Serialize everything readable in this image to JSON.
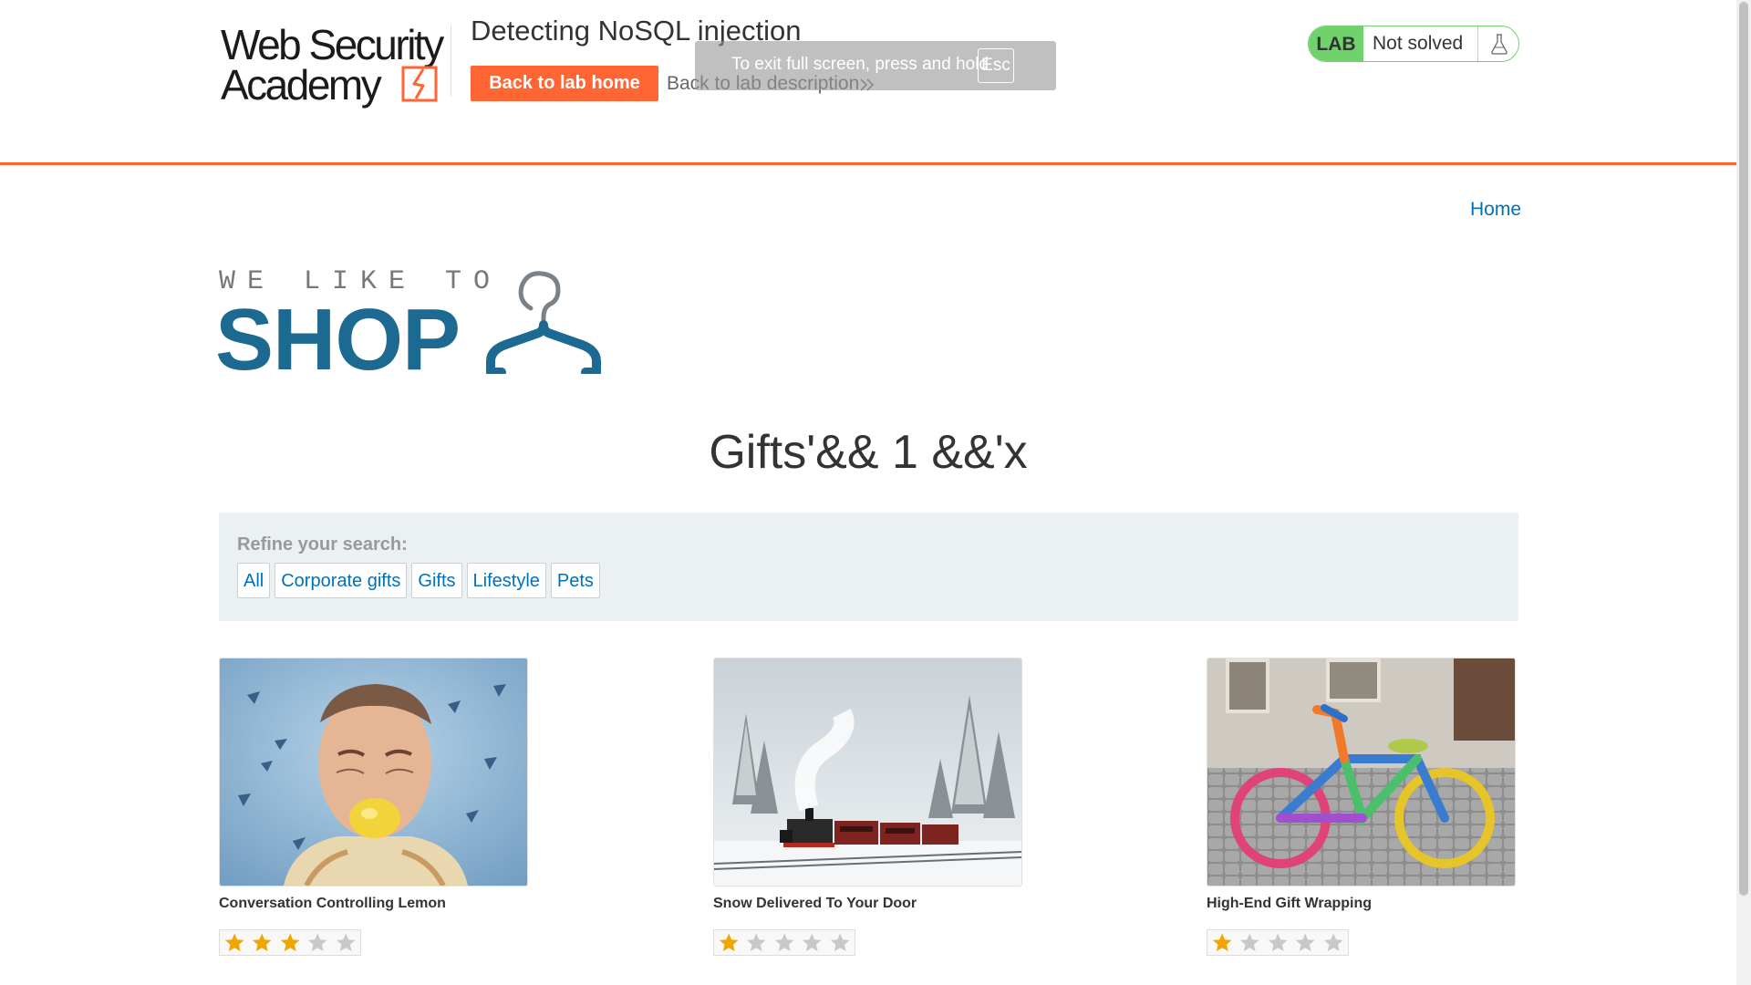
{
  "header": {
    "logo_line1": "Web Security",
    "logo_line2": "Academy",
    "lab_title": "Detecting NoSQL injection",
    "back_home_label": "Back to lab home",
    "back_description_label": "Back to lab description",
    "fullscreen_notice": {
      "message": "To exit full screen, press and hold",
      "key": "Esc"
    },
    "lab_status": {
      "tag": "LAB",
      "state": "Not solved"
    }
  },
  "nav": {
    "home_label": "Home"
  },
  "shop_logo": {
    "tagline": "WE LIKE TO",
    "name": "SHOP"
  },
  "category_title": "Gifts'&& 1 &&'x",
  "filters": {
    "label": "Refine your search:",
    "items": [
      "All",
      "Corporate gifts",
      "Gifts",
      "Lifestyle",
      "Pets"
    ]
  },
  "products": [
    {
      "name": "Conversation Controlling Lemon",
      "rating": 3,
      "max_rating": 5,
      "image": "man-biting-lemon"
    },
    {
      "name": "Snow Delivered To Your Door",
      "rating": 1,
      "max_rating": 5,
      "image": "steam-train-in-snow"
    },
    {
      "name": "High-End Gift Wrapping",
      "rating": 1,
      "max_rating": 5,
      "image": "yarn-wrapped-bicycle"
    }
  ],
  "colors": {
    "accent": "#ff6633",
    "link": "#0071bc",
    "shop_brand": "#1c6a92",
    "lab_green": "#70d16d",
    "star_filled": "#f0a500",
    "star_empty": "#c8c8c8"
  }
}
